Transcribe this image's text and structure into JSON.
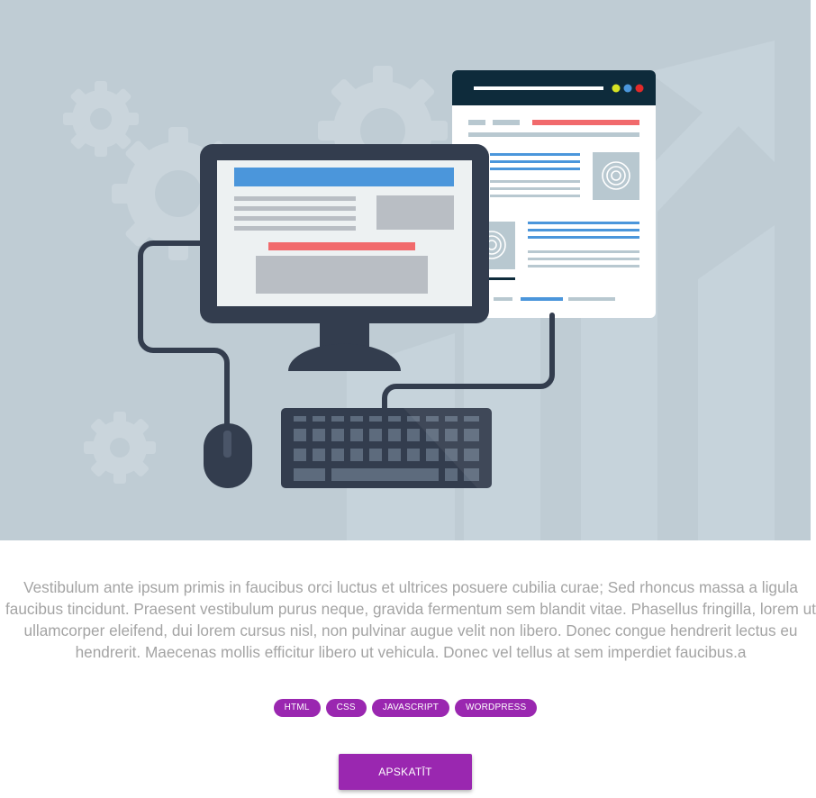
{
  "colors": {
    "hero_background": "#bfccd4",
    "accent": "#9a27b0",
    "text_muted": "#a4a4a4",
    "monitor_dark": "#333d4e",
    "screen_blue": "#4b96db",
    "screen_red": "#f16a6c"
  },
  "hero": {
    "illustration": "desktop-computer-webpage-illustration",
    "icons": [
      "gear-icon",
      "monitor-icon",
      "browser-window-icon",
      "keyboard-icon",
      "mouse-icon",
      "target-icon",
      "trend-arrow-icon"
    ]
  },
  "content": {
    "description": "Vestibulum ante ipsum primis in faucibus orci luctus et ultrices posuere cubilia curae; Sed rhoncus massa a ligula faucibus tincidunt. Praesent vestibulum purus neque, gravida fermentum sem blandit vitae. Phasellus fringilla, lorem ut ullamcorper eleifend, dui lorem cursus nisl, non pulvinar augue velit non libero. Donec congue hendrerit lectus eu hendrerit. Maecenas mollis efficitur libero ut vehicula. Donec vel tellus at sem imperdiet faucibus.a"
  },
  "tags": [
    {
      "label": "HTML"
    },
    {
      "label": "CSS"
    },
    {
      "label": "JAVASCRIPT"
    },
    {
      "label": "WORDPRESS"
    }
  ],
  "actions": {
    "view_label": "APSKATĪT"
  }
}
